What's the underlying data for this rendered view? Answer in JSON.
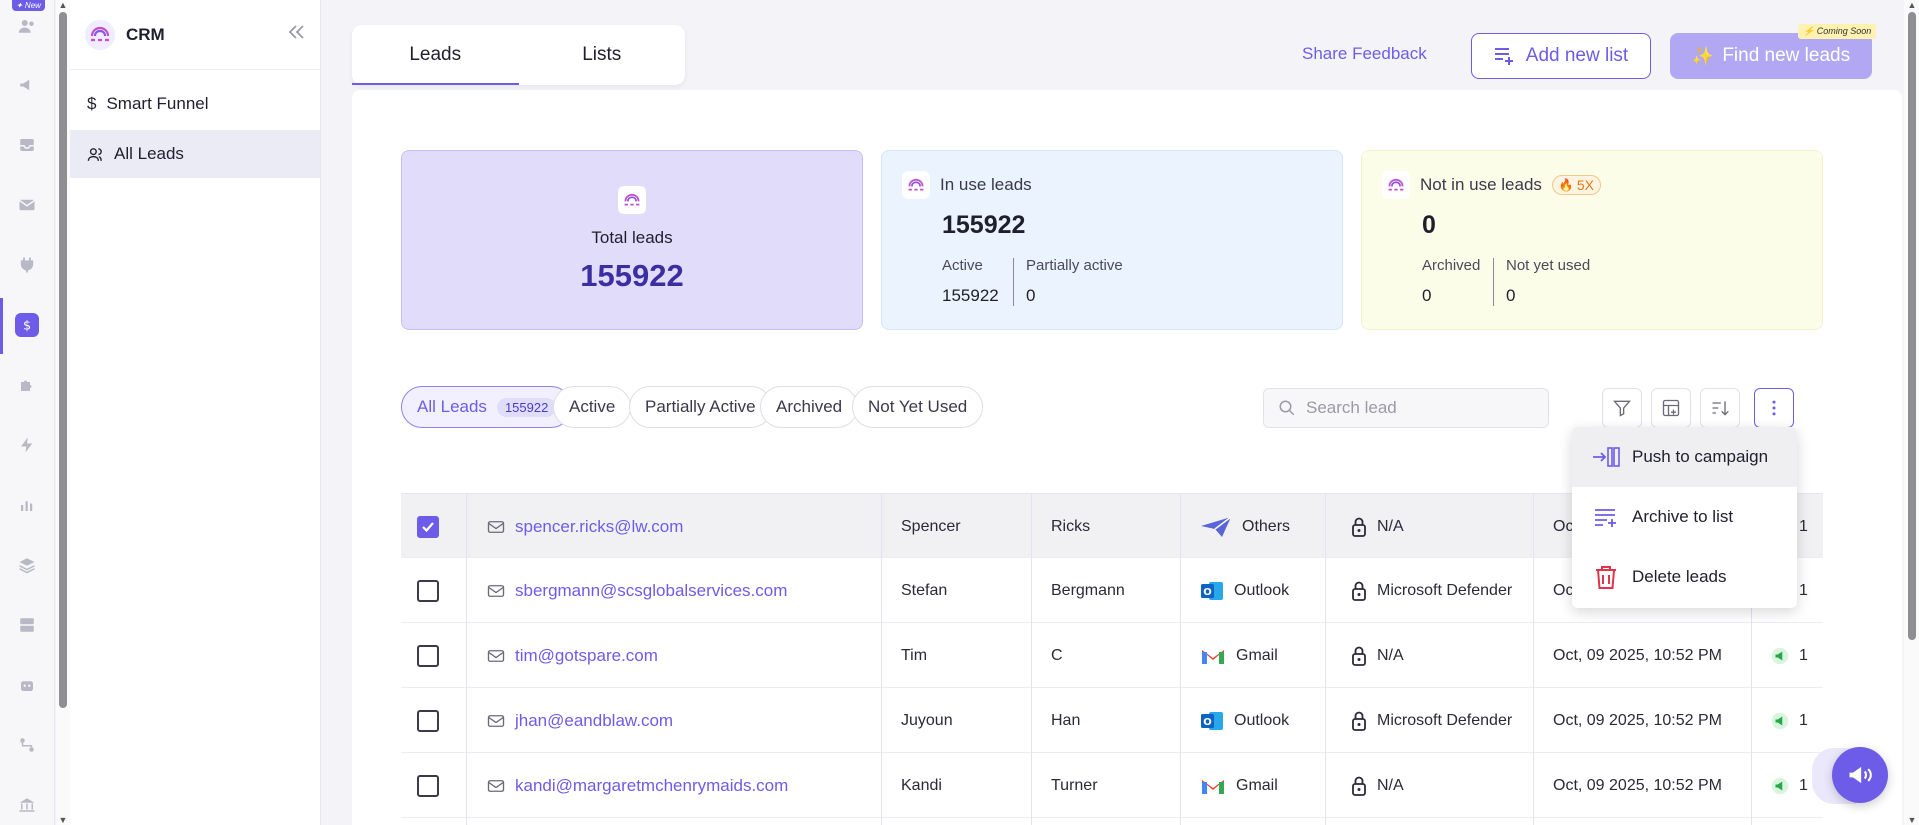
{
  "rail": {
    "new_badge": "✦ New"
  },
  "sidebar": {
    "title": "CRM",
    "items": [
      {
        "label": "Smart Funnel",
        "icon": "dollar-icon"
      },
      {
        "label": "All Leads",
        "icon": "users-icon"
      }
    ]
  },
  "header": {
    "tabs": [
      "Leads",
      "Lists"
    ],
    "share_feedback": "Share Feedback",
    "add_list": "Add new list",
    "find_leads": "Find new leads",
    "coming_soon": "⚡ Coming Soon"
  },
  "stats": {
    "total": {
      "label": "Total leads",
      "value": "155922"
    },
    "in_use": {
      "label": "In use leads",
      "value": "155922",
      "sub1_label": "Active",
      "sub1_value": "155922",
      "sub2_label": "Partially active",
      "sub2_value": "0"
    },
    "not_in_use": {
      "label": "Not in use leads",
      "badge": "5X",
      "value": "0",
      "sub1_label": "Archived",
      "sub1_value": "0",
      "sub2_label": "Not yet used",
      "sub2_value": "0"
    }
  },
  "filters": {
    "chips": [
      {
        "label": "All Leads",
        "count": "155922"
      },
      {
        "label": "Active"
      },
      {
        "label": "Partially Active"
      },
      {
        "label": "Archived"
      },
      {
        "label": "Not Yet Used"
      }
    ],
    "search_placeholder": "Search lead"
  },
  "menu": {
    "items": [
      "Push to campaign",
      "Archive to list",
      "Delete leads"
    ]
  },
  "table": {
    "rows": [
      {
        "email": "spencer.ricks@lw.com",
        "first": "Spencer",
        "last": "Ricks",
        "provider": "Others",
        "security": "N/A",
        "date": "Oc",
        "count": "1",
        "checked": true
      },
      {
        "email": "sbergmann@scsglobalservices.com",
        "first": "Stefan",
        "last": "Bergmann",
        "provider": "Outlook",
        "security": "Microsoft Defender",
        "date": "Oc",
        "count": "1",
        "checked": false
      },
      {
        "email": "tim@gotspare.com",
        "first": "Tim",
        "last": "C",
        "provider": "Gmail",
        "security": "N/A",
        "date": "Oct, 09 2025, 10:52 PM",
        "count": "1",
        "checked": false
      },
      {
        "email": "jhan@eandblaw.com",
        "first": "Juyoun",
        "last": "Han",
        "provider": "Outlook",
        "security": "Microsoft Defender",
        "date": "Oct, 09 2025, 10:52 PM",
        "count": "1",
        "checked": false
      },
      {
        "email": "kandi@margaretmchenrymaids.com",
        "first": "Kandi",
        "last": "Turner",
        "provider": "Gmail",
        "security": "N/A",
        "date": "Oct, 09 2025, 10:52 PM",
        "count": "1",
        "checked": false
      }
    ]
  },
  "colors": {
    "accent": "#6d5ce8",
    "total_bg": "#e2dcfb",
    "in_use_bg": "#eaf3fe",
    "not_use_bg": "#fcfde9"
  }
}
